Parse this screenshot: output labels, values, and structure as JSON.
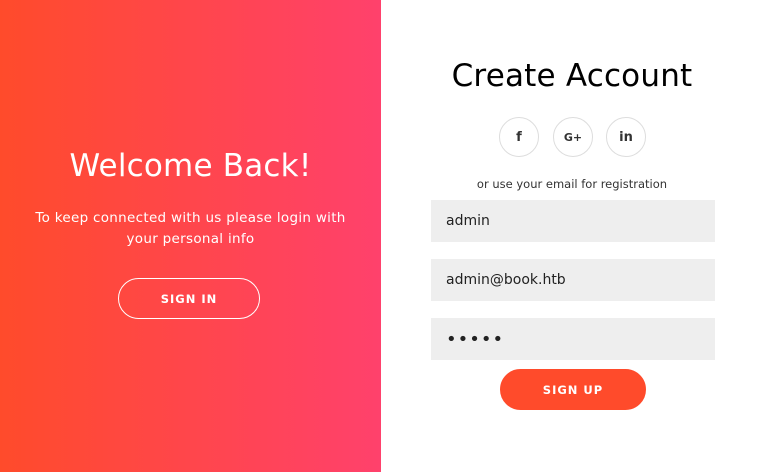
{
  "overlay": {
    "title": "Welcome Back!",
    "text": "To keep connected with us please login with your personal info",
    "signin_label": "SIGN IN"
  },
  "form": {
    "title": "Create Account",
    "social": {
      "facebook_glyph": "f",
      "google_glyph": "G+",
      "linkedin_glyph": "in"
    },
    "subtitle": "or use your email for registration",
    "name_value": "admin",
    "email_value": "admin@book.htb",
    "password_value": "admin",
    "signup_label": "SIGN UP"
  },
  "colors": {
    "gradient_start": "#ff4b2b",
    "gradient_end": "#ff416c",
    "input_bg": "#eeeeee",
    "button_bg": "#ff4b2b"
  },
  "icons": [
    "facebook-icon",
    "google-plus-icon",
    "linkedin-icon"
  ]
}
